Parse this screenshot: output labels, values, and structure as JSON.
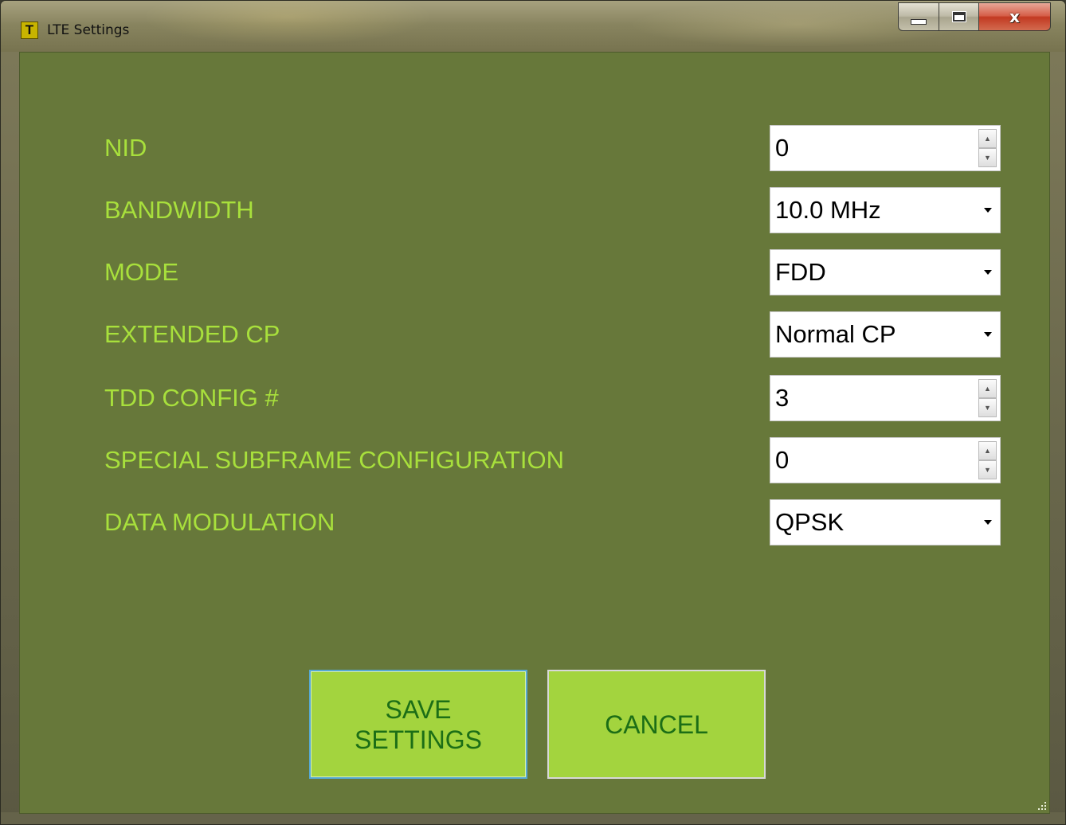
{
  "window": {
    "title": "LTE Settings",
    "icon_letter": "T",
    "icon": "app-t-icon",
    "controls": [
      "minimize-icon",
      "maximize-icon",
      "close-icon"
    ],
    "close_glyph": "x"
  },
  "colors": {
    "client_bg": "#67783a",
    "label_text": "#a8e03c",
    "button_bg": "#a3d43e",
    "button_text": "#1c6e16",
    "focus_border": "#56a9d6"
  },
  "form": {
    "rows": [
      {
        "label": "NID",
        "value": "0",
        "control": "spinner"
      },
      {
        "label": "BANDWIDTH",
        "value": "10.0 MHz",
        "control": "dropdown"
      },
      {
        "label": "MODE",
        "value": "FDD",
        "control": "dropdown"
      },
      {
        "label": "EXTENDED CP",
        "value": "Normal CP",
        "control": "dropdown"
      },
      {
        "label": "TDD CONFIG #",
        "value": "3",
        "control": "spinner"
      },
      {
        "label": "SPECIAL SUBFRAME CONFIGURATION",
        "value": "0",
        "control": "spinner"
      },
      {
        "label": "DATA MODULATION",
        "value": "QPSK",
        "control": "dropdown"
      }
    ]
  },
  "buttons": {
    "save": "SAVE\nSETTINGS",
    "cancel": "CANCEL"
  }
}
